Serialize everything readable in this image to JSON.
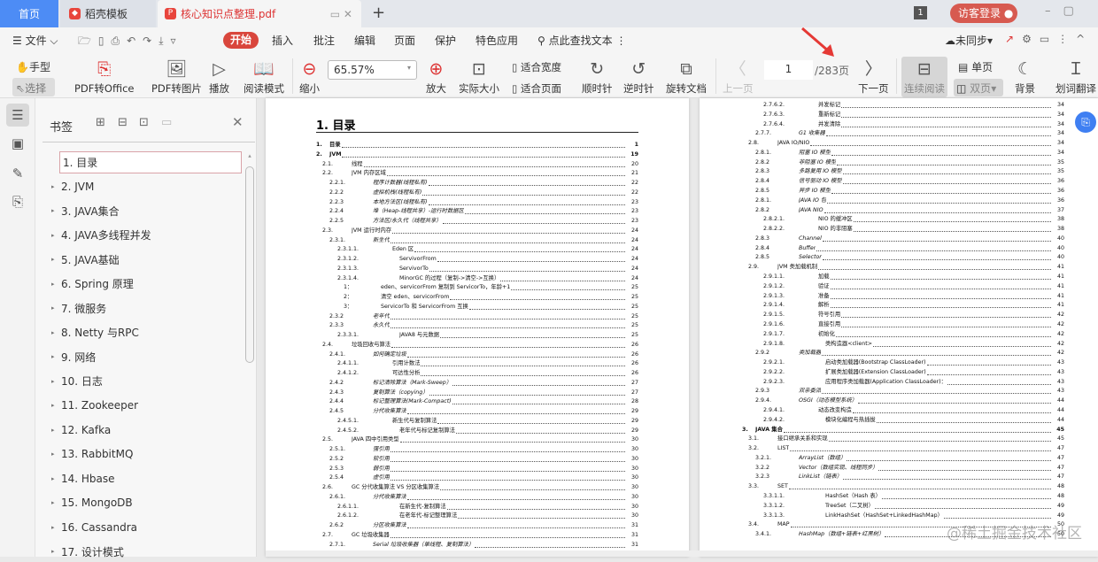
{
  "tabs": {
    "home": "首页",
    "template": "稻壳模板",
    "doc": "核心知识点整理.pdf"
  },
  "titlebar": {
    "badge": "1",
    "login": "访客登录"
  },
  "menu": {
    "file": "文件",
    "items": [
      "开始",
      "插入",
      "批注",
      "编辑",
      "页面",
      "保护",
      "特色应用"
    ],
    "search": "点此查找文本",
    "sync": "未同步"
  },
  "toolbar": {
    "hand": "手型",
    "select": "选择",
    "pdf_office": "PDF转Office",
    "pdf_image": "PDF转图片",
    "play": "播放",
    "read_mode": "阅读模式",
    "zoom_out": "缩小",
    "zoom": "65.57%",
    "zoom_in": "放大",
    "actual": "实际大小",
    "fit_width": "适合宽度",
    "fit_page": "适合页面",
    "cw": "顺时针",
    "ccw": "逆时针",
    "rotate": "旋转文档",
    "prev": "上一页",
    "page": "1",
    "total": "/283页",
    "next": "下一页",
    "continuous": "连续阅读",
    "single": "单页",
    "double": "双页",
    "background": "背景",
    "translate": "划词翻译"
  },
  "bookmarks": {
    "title": "书签",
    "items": [
      "1. 目录",
      "2. JVM",
      "3. JAVA集合",
      "4. JAVA多线程并发",
      "5. JAVA基础",
      "6. Spring 原理",
      "7.  微服务",
      "8. Netty 与RPC",
      "9. 网络",
      "10. 日志",
      "11. Zookeeper",
      "12. Kafka",
      "13. RabbitMQ",
      "14. Hbase",
      "15. MongoDB",
      "16. Cassandra",
      "17. 设计模式"
    ]
  },
  "doc": {
    "title": "1. 目录",
    "left": [
      [
        0,
        "b",
        "1.",
        "目录",
        "1"
      ],
      [
        0,
        "b",
        "2.",
        "JVM",
        "19"
      ],
      [
        1,
        "n",
        "2.1.",
        "线程",
        "20"
      ],
      [
        1,
        "n",
        "2.2.",
        "JVM 内存区域",
        "21"
      ],
      [
        2,
        "i",
        "2.2.1.",
        "程序计数器(线程私有)",
        "22"
      ],
      [
        2,
        "i",
        "2.2.2",
        "虚拟机栈(线程私有)",
        "22"
      ],
      [
        2,
        "i",
        "2.2.3",
        "本地方法区(线程私有)",
        "23"
      ],
      [
        2,
        "i",
        "2.2.4",
        "堆（Heap-线程共享）-运行时数据区",
        "23"
      ],
      [
        2,
        "i",
        "2.2.5",
        "方法区/永久代（线程共享）",
        "23"
      ],
      [
        1,
        "n",
        "2.3.",
        "JVM 运行时内存",
        "24"
      ],
      [
        2,
        "i",
        "2.3.1.",
        "新生代",
        "24"
      ],
      [
        3,
        "n",
        "2.3.1.1.",
        "Eden 区",
        "24"
      ],
      [
        3,
        "n",
        "2.3.1.2.",
        "ServivorFrom",
        "24"
      ],
      [
        3,
        "n",
        "2.3.1.3.",
        "ServivorTo",
        "24"
      ],
      [
        3,
        "n",
        "2.3.1.4.",
        "MinorGC 的过程（复制->清空->互换）",
        "24"
      ],
      [
        4,
        "n",
        "1：",
        "eden、servicorFrom 复制到 ServicorTo，年龄+1",
        "25"
      ],
      [
        4,
        "n",
        "2：",
        "清空 eden、servicorFrom",
        "25"
      ],
      [
        4,
        "n",
        "3：",
        "ServicorTo 和 ServicorFrom 互换",
        "25"
      ],
      [
        2,
        "i",
        "2.3.2",
        "老年代",
        "25"
      ],
      [
        2,
        "i",
        "2.3.3",
        "永久代",
        "25"
      ],
      [
        3,
        "n",
        "2.3.3.1.",
        "JAVA8 与元数据",
        "25"
      ],
      [
        1,
        "n",
        "2.4.",
        "垃圾回收与算法",
        "26"
      ],
      [
        2,
        "i",
        "2.4.1.",
        "如何确定垃圾",
        "26"
      ],
      [
        3,
        "n",
        "2.4.1.1.",
        "引用计数法",
        "26"
      ],
      [
        3,
        "n",
        "2.4.1.2.",
        "可达性分析",
        "26"
      ],
      [
        2,
        "i",
        "2.4.2",
        "标记清除算法（Mark-Sweep）",
        "27"
      ],
      [
        2,
        "i",
        "2.4.3",
        "复制算法（copying）",
        "27"
      ],
      [
        2,
        "i",
        "2.4.4",
        "标记整理算法(Mark-Compact)",
        "28"
      ],
      [
        2,
        "i",
        "2.4.5",
        "分代收集算法",
        "29"
      ],
      [
        3,
        "n",
        "2.4.5.1.",
        "新生代与复制算法",
        "29"
      ],
      [
        3,
        "n",
        "2.4.5.2.",
        "老年代与标记复制算法",
        "29"
      ],
      [
        1,
        "n",
        "2.5.",
        "JAVA 四中引用类型",
        "30"
      ],
      [
        2,
        "i",
        "2.5.1.",
        "强引用",
        "30"
      ],
      [
        2,
        "i",
        "2.5.2",
        "软引用",
        "30"
      ],
      [
        2,
        "i",
        "2.5.3",
        "弱引用",
        "30"
      ],
      [
        2,
        "i",
        "2.5.4",
        "虚引用",
        "30"
      ],
      [
        1,
        "n",
        "2.6.",
        "GC 分代收集算法 VS 分区收集算法",
        "30"
      ],
      [
        2,
        "i",
        "2.6.1.",
        "分代收集算法",
        "30"
      ],
      [
        3,
        "n",
        "2.6.1.1.",
        "在新生代-复制算法",
        "30"
      ],
      [
        3,
        "n",
        "2.6.1.2.",
        "在老年代-标记整理算法",
        "30"
      ],
      [
        2,
        "i",
        "2.6.2",
        "分区收集算法",
        "31"
      ],
      [
        1,
        "n",
        "2.7.",
        "GC 垃圾收集器",
        "31"
      ],
      [
        2,
        "i",
        "2.7.1.",
        "Serial 垃圾收集器（单线程、复制算法）",
        "31"
      ]
    ],
    "right": [
      [
        3,
        "n",
        "2.7.6.2.",
        "并发标记",
        "34"
      ],
      [
        3,
        "n",
        "2.7.6.3.",
        "重新标记",
        "34"
      ],
      [
        3,
        "n",
        "2.7.6.4.",
        "并发清除",
        "34"
      ],
      [
        2,
        "i",
        "2.7.7.",
        "G1 收集器",
        "34"
      ],
      [
        1,
        "n",
        "2.8.",
        "JAVA IO/NIO",
        "34"
      ],
      [
        2,
        "i",
        "2.8.1.",
        "阻塞 IO 模型",
        "34"
      ],
      [
        2,
        "i",
        "2.8.2",
        "非阻塞 IO 模型",
        "35"
      ],
      [
        2,
        "i",
        "2.8.3",
        "多路复用 IO 模型",
        "35"
      ],
      [
        2,
        "i",
        "2.8.4",
        "信号驱动 IO 模型",
        "36"
      ],
      [
        2,
        "i",
        "2.8.5",
        "异步 IO 模型",
        "36"
      ],
      [
        2,
        "i",
        "2.8.1.",
        "JAVA IO 包",
        "36"
      ],
      [
        2,
        "i",
        "2.8.2",
        "JAVA NIO",
        "37"
      ],
      [
        3,
        "n",
        "2.8.2.1.",
        "NIO 的缓冲区",
        "38"
      ],
      [
        3,
        "n",
        "2.8.2.2.",
        "NIO 的非阻塞",
        "38"
      ],
      [
        2,
        "i",
        "2.8.3",
        "Channel",
        "40"
      ],
      [
        2,
        "i",
        "2.8.4",
        "Buffer",
        "40"
      ],
      [
        2,
        "i",
        "2.8.5",
        "Selector",
        "40"
      ],
      [
        1,
        "n",
        "2.9.",
        "JVM 类加载机制",
        "41"
      ],
      [
        3,
        "n",
        "2.9.1.1.",
        "加载",
        "41"
      ],
      [
        3,
        "n",
        "2.9.1.2.",
        "验证",
        "41"
      ],
      [
        3,
        "n",
        "2.9.1.3.",
        "准备",
        "41"
      ],
      [
        3,
        "n",
        "2.9.1.4.",
        "解析",
        "41"
      ],
      [
        3,
        "n",
        "2.9.1.5.",
        "符号引用",
        "42"
      ],
      [
        3,
        "n",
        "2.9.1.6.",
        "直接引用",
        "42"
      ],
      [
        3,
        "n",
        "2.9.1.7.",
        "初始化",
        "42"
      ],
      [
        3,
        "n",
        "2.9.1.8.",
        "类构造器<client>",
        "42"
      ],
      [
        2,
        "i",
        "2.9.2",
        "类加载器",
        "42"
      ],
      [
        3,
        "n",
        "2.9.2.1.",
        "启动类加载器(Bootstrap ClassLoader)",
        "43"
      ],
      [
        3,
        "n",
        "2.9.2.2.",
        "扩展类加载器(Extension ClassLoader)",
        "43"
      ],
      [
        3,
        "n",
        "2.9.2.3.",
        "应用程序类加载器(Application ClassLoader)：",
        "43"
      ],
      [
        2,
        "i",
        "2.9.3",
        "双亲委派",
        "43"
      ],
      [
        2,
        "i",
        "2.9.4.",
        "OSGI（动态模型系统）",
        "44"
      ],
      [
        3,
        "n",
        "2.9.4.1.",
        "动态改变构造",
        "44"
      ],
      [
        3,
        "n",
        "2.9.4.2.",
        "模块化编程与热插拔",
        "44"
      ],
      [
        0,
        "b",
        "3.",
        "JAVA 集合",
        "45"
      ],
      [
        1,
        "n",
        "3.1.",
        "接口继承关系和实现",
        "45"
      ],
      [
        1,
        "n",
        "3.2.",
        "LIST",
        "47"
      ],
      [
        2,
        "i",
        "3.2.1.",
        "ArrayList（数组）",
        "47"
      ],
      [
        2,
        "i",
        "3.2.2",
        "Vector（数组实现、线程同步）",
        "47"
      ],
      [
        2,
        "i",
        "3.2.3",
        "LinkList（链表）",
        "47"
      ],
      [
        1,
        "n",
        "3.3.",
        "SET",
        "48"
      ],
      [
        3,
        "n",
        "3.3.1.1.",
        "HashSet（Hash 表）",
        "48"
      ],
      [
        3,
        "n",
        "3.3.1.2.",
        "TreeSet（二叉树）",
        "49"
      ],
      [
        3,
        "n",
        "3.3.1.3.",
        "LinkHashSet（HashSet+LinkedHashMap）",
        "49"
      ],
      [
        1,
        "n",
        "3.4.",
        "MAP",
        "50"
      ],
      [
        2,
        "i",
        "3.4.1.",
        "HashMap（数组+链表+红黑树）",
        "50"
      ]
    ]
  },
  "watermark": "@稀土掘金技术社区",
  "colors": {
    "accent": "#d9463c",
    "home_tab": "#4d8cf5"
  }
}
